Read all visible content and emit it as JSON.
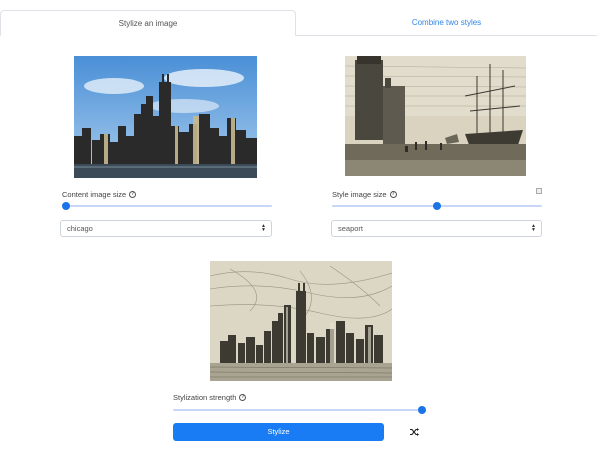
{
  "tabs": {
    "stylize_label": "Stylize an image",
    "combine_label": "Combine two styles"
  },
  "content": {
    "size_label": "Content image size",
    "slider_value": 0.0,
    "selected_image": "chicago"
  },
  "style": {
    "size_label": "Style image size",
    "slider_value": 0.5,
    "selected_image": "seaport"
  },
  "stylization": {
    "strength_label": "Stylization strength",
    "slider_value": 1.0
  },
  "actions": {
    "stylize_label": "Stylize",
    "random_icon": "shuffle-icon"
  },
  "colors": {
    "accent": "#1a7cf5",
    "tab_link": "#2f86e6"
  }
}
